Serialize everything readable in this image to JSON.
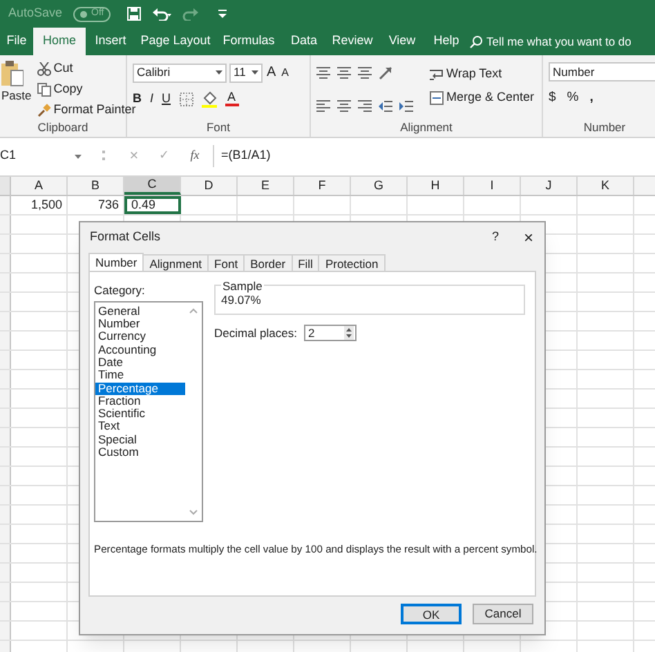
{
  "title_bar": {
    "autosave_label": "AutoSave",
    "autosave_state": "Off"
  },
  "ribbon_tabs": [
    {
      "label": "File",
      "selected": false
    },
    {
      "label": "Home",
      "selected": true
    },
    {
      "label": "Insert",
      "selected": false
    },
    {
      "label": "Page Layout",
      "selected": false
    },
    {
      "label": "Formulas",
      "selected": false
    },
    {
      "label": "Data",
      "selected": false
    },
    {
      "label": "Review",
      "selected": false
    },
    {
      "label": "View",
      "selected": false
    },
    {
      "label": "Help",
      "selected": false
    }
  ],
  "search": {
    "placeholder": "Tell me what you want to do"
  },
  "clipboard": {
    "paste": "Paste",
    "cut": "Cut",
    "copy": "Copy",
    "format_painter": "Format Painter",
    "label": "Clipboard"
  },
  "font": {
    "name": "Calibri",
    "size": "11",
    "grow": "A",
    "shrink": "A",
    "bold": "B",
    "italic": "I",
    "underline": "U",
    "font_color": "A",
    "label": "Font"
  },
  "alignment": {
    "wrap": "Wrap Text",
    "merge": "Merge & Center",
    "label": "Alignment"
  },
  "number": {
    "format": "Number",
    "currency": "$",
    "percent": "%",
    "comma": ",",
    "label": "Number"
  },
  "formula_bar": {
    "name_box": "C1",
    "cancel": "×",
    "enter": "✓",
    "fx": "fx",
    "formula": "=(B1/A1)"
  },
  "columns": [
    {
      "label": "A",
      "selected": false
    },
    {
      "label": "B",
      "selected": false
    },
    {
      "label": "C",
      "selected": true
    },
    {
      "label": "D",
      "selected": false
    },
    {
      "label": "E",
      "selected": false
    },
    {
      "label": "F",
      "selected": false
    },
    {
      "label": "G",
      "selected": false
    },
    {
      "label": "H",
      "selected": false
    },
    {
      "label": "I",
      "selected": false
    },
    {
      "label": "J",
      "selected": false
    },
    {
      "label": "K",
      "selected": false
    }
  ],
  "row_1": [
    {
      "value": "1,500",
      "selected": false
    },
    {
      "value": "736",
      "selected": false
    },
    {
      "value": "0.49",
      "selected": true
    }
  ],
  "dialog": {
    "title": "Format Cells",
    "help": "?",
    "close": "×",
    "tabs": [
      {
        "label": "Number",
        "selected": true
      },
      {
        "label": "Alignment",
        "selected": false
      },
      {
        "label": "Font",
        "selected": false
      },
      {
        "label": "Border",
        "selected": false
      },
      {
        "label": "Fill",
        "selected": false
      },
      {
        "label": "Protection",
        "selected": false
      }
    ],
    "category_label": "Category:",
    "categories": [
      {
        "label": "General",
        "selected": false
      },
      {
        "label": "Number",
        "selected": false
      },
      {
        "label": "Currency",
        "selected": false
      },
      {
        "label": "Accounting",
        "selected": false
      },
      {
        "label": "Date",
        "selected": false
      },
      {
        "label": "Time",
        "selected": false
      },
      {
        "label": "Percentage",
        "selected": true
      },
      {
        "label": "Fraction",
        "selected": false
      },
      {
        "label": "Scientific",
        "selected": false
      },
      {
        "label": "Text",
        "selected": false
      },
      {
        "label": "Special",
        "selected": false
      },
      {
        "label": "Custom",
        "selected": false
      }
    ],
    "sample_label": "Sample",
    "sample_value": "49.07%",
    "decimal_label": "Decimal places:",
    "decimal_value": "2",
    "description": "Percentage formats multiply the cell value by 100 and displays the result with a percent symbol.",
    "buttons": [
      {
        "label": "OK",
        "focused": true
      },
      {
        "label": "Cancel",
        "focused": false
      }
    ]
  }
}
